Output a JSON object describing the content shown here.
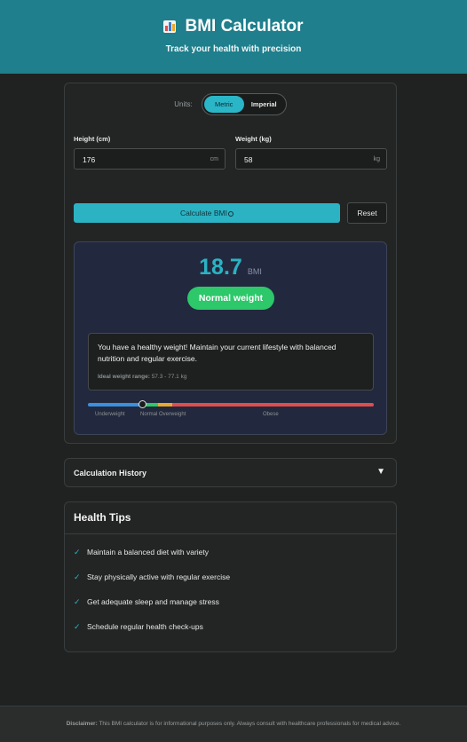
{
  "header": {
    "title": "BMI Calculator",
    "subtitle": "Track your health with precision",
    "icon": "bar-chart-icon"
  },
  "units": {
    "label": "Units:",
    "options": [
      "Metric",
      "Imperial"
    ],
    "selected": "Metric"
  },
  "height": {
    "label": "Height (cm)",
    "value": "176",
    "unit": "cm"
  },
  "weight": {
    "label": "Weight (kg)",
    "value": "58",
    "unit": "kg"
  },
  "buttons": {
    "calculate": "Calculate BMI",
    "reset": "Reset"
  },
  "result": {
    "bmi": "18.7",
    "bmi_unit": "BMI",
    "category": "Normal weight",
    "advice": "You have a healthy weight! Maintain your current lifestyle with balanced nutrition and regular exercise.",
    "ideal_label": "Ideal weight range:",
    "ideal_value": "57.3 - 77.1 kg",
    "scale_labels": [
      "Underweight",
      "Normal",
      "Overweight",
      "Obese"
    ],
    "indicator_fraction": 0.19
  },
  "history": {
    "title": "Calculation History",
    "toggle_glyph": "▼"
  },
  "tips": {
    "title": "Health Tips",
    "check_glyph": "✓",
    "items": [
      "Maintain a balanced diet with variety",
      "Stay physically active with regular exercise",
      "Get adequate sleep and manage stress",
      "Schedule regular health check-ups"
    ]
  },
  "footer": {
    "label": "Disclaimer:",
    "text": "This BMI calculator is for informational purposes only. Always consult with healthcare professionals for medical advice."
  },
  "colors": {
    "accent": "#2bb3c4",
    "header": "#1f7f8c",
    "normal": "#2cc86a",
    "underweight": "#3a8fdf",
    "overweight": "#e8a92e",
    "obese": "#e14c4c"
  }
}
